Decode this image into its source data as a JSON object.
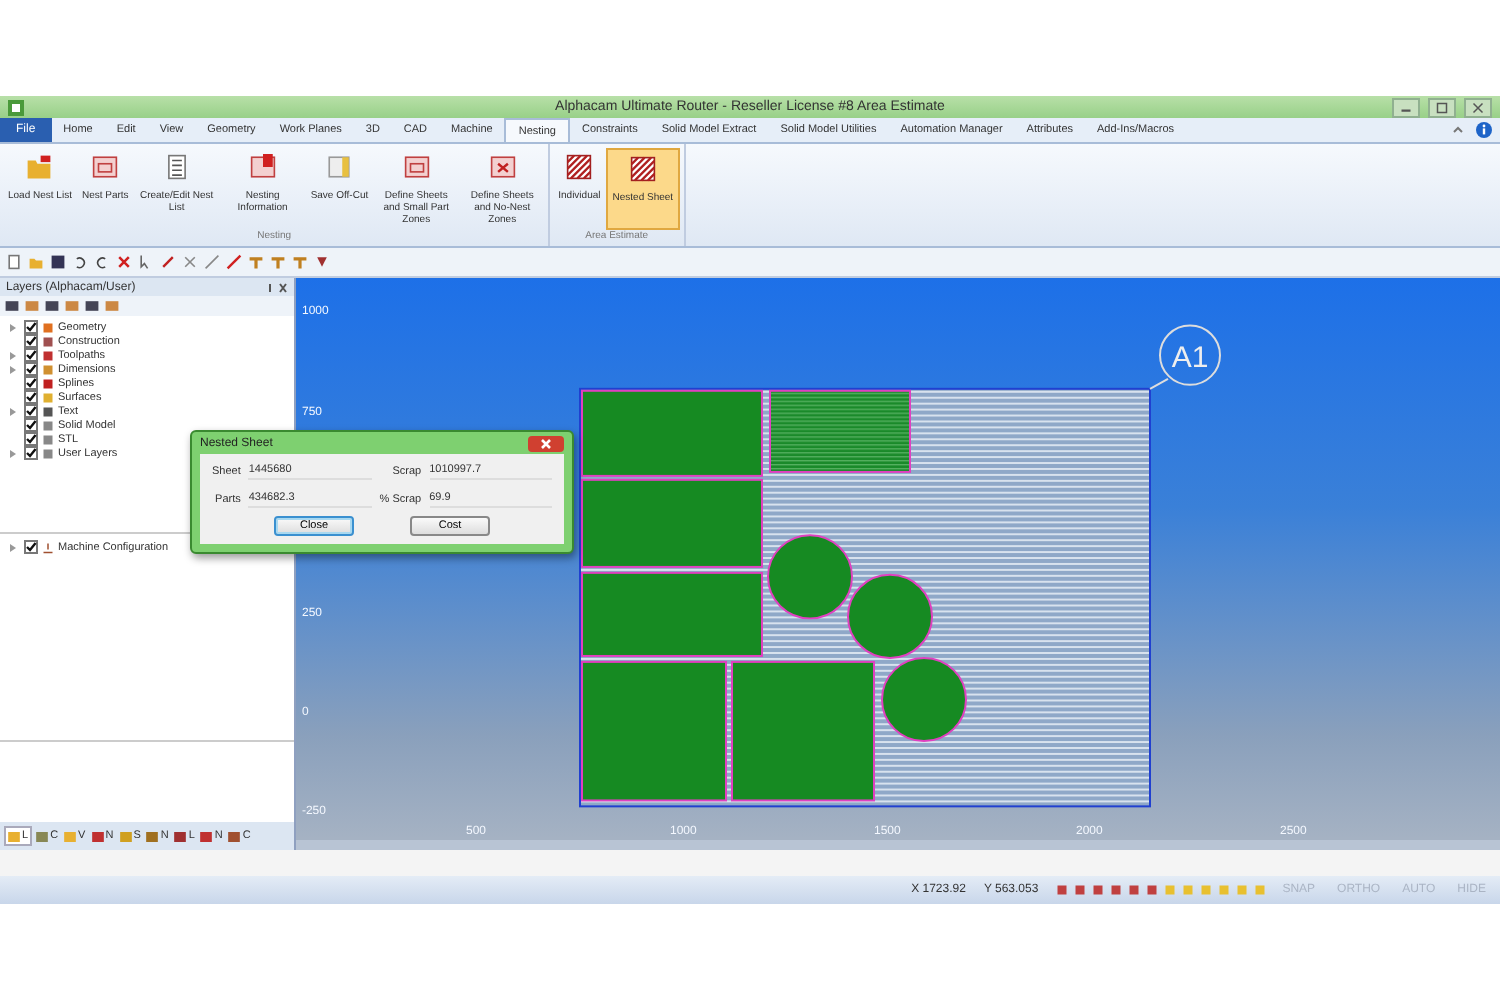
{
  "window": {
    "title": "Alphacam Ultimate Router - Reseller License #8 Area Estimate"
  },
  "tabs": [
    {
      "label": "File",
      "selected": false,
      "kind": "file"
    },
    {
      "label": "Home",
      "selected": false,
      "kind": "tab"
    },
    {
      "label": "Edit",
      "selected": false,
      "kind": "tab"
    },
    {
      "label": "View",
      "selected": false,
      "kind": "tab"
    },
    {
      "label": "Geometry",
      "selected": false,
      "kind": "tab"
    },
    {
      "label": "Work Planes",
      "selected": false,
      "kind": "tab"
    },
    {
      "label": "3D",
      "selected": false,
      "kind": "tab"
    },
    {
      "label": "CAD",
      "selected": false,
      "kind": "tab"
    },
    {
      "label": "Machine",
      "selected": false,
      "kind": "tab"
    },
    {
      "label": "Nesting",
      "selected": true,
      "kind": "tab"
    },
    {
      "label": "Constraints",
      "selected": false,
      "kind": "tab"
    },
    {
      "label": "Solid Model Extract",
      "selected": false,
      "kind": "tab"
    },
    {
      "label": "Solid Model Utilities",
      "selected": false,
      "kind": "tab"
    },
    {
      "label": "Automation Manager",
      "selected": false,
      "kind": "tab"
    },
    {
      "label": "Attributes",
      "selected": false,
      "kind": "tab"
    },
    {
      "label": "Add-Ins/Macros",
      "selected": false,
      "kind": "tab"
    }
  ],
  "ribbon_groups": [
    {
      "label": "Nesting",
      "buttons": [
        {
          "label": "Load Nest List",
          "selected": false
        },
        {
          "label": "Nest Parts",
          "selected": false
        },
        {
          "label": "Create/Edit Nest List",
          "selected": false
        },
        {
          "label": "Nesting Information",
          "selected": false
        },
        {
          "label": "Save Off-Cut",
          "selected": false
        },
        {
          "label": "Define Sheets and Small Part Zones",
          "selected": false
        },
        {
          "label": "Define Sheets and No-Nest Zones",
          "selected": false
        }
      ]
    },
    {
      "label": "Area Estimate",
      "buttons": [
        {
          "label": "Individual",
          "selected": false
        },
        {
          "label": "Nested Sheet",
          "selected": true
        }
      ]
    }
  ],
  "layers_panel": {
    "title": "Layers (Alphacam/User)",
    "items": [
      {
        "label": "Geometry",
        "expandable": true,
        "checked": true
      },
      {
        "label": "Construction",
        "expandable": false,
        "checked": true
      },
      {
        "label": "Toolpaths",
        "expandable": true,
        "checked": true
      },
      {
        "label": "Dimensions",
        "expandable": true,
        "checked": true
      },
      {
        "label": "Splines",
        "expandable": false,
        "checked": true
      },
      {
        "label": "Surfaces",
        "expandable": false,
        "checked": true
      },
      {
        "label": "Text",
        "expandable": true,
        "checked": true
      },
      {
        "label": "Solid Model",
        "expandable": false,
        "checked": true
      },
      {
        "label": "STL",
        "expandable": false,
        "checked": true
      },
      {
        "label": "User Layers",
        "expandable": true,
        "checked": true
      }
    ],
    "machine_items": [
      {
        "label": "Machine Configuration",
        "expandable": true,
        "checked": true
      }
    ],
    "bottom_tabs": [
      {
        "label": "L",
        "selected": true
      },
      {
        "label": "C",
        "selected": false
      },
      {
        "label": "V",
        "selected": false
      },
      {
        "label": "N",
        "selected": false
      },
      {
        "label": "S",
        "selected": false
      },
      {
        "label": "N",
        "selected": false
      },
      {
        "label": "L",
        "selected": false
      },
      {
        "label": "N",
        "selected": false
      },
      {
        "label": "C",
        "selected": false
      }
    ]
  },
  "canvas": {
    "y_labels": [
      "1000",
      "750",
      "250",
      "0",
      "-250"
    ],
    "x_labels": [
      "500",
      "1000",
      "1500",
      "2000",
      "2500"
    ],
    "sheet_label": "A1"
  },
  "dialog": {
    "title": "Nested Sheet",
    "fields": [
      {
        "label": "Sheet",
        "value": "1445680"
      },
      {
        "label": "Scrap",
        "value": "1010997.7"
      },
      {
        "label": "Parts",
        "value": "434682.3"
      },
      {
        "label": "% Scrap",
        "value": "69.9"
      }
    ],
    "buttons": [
      {
        "label": "Close",
        "selected": true
      },
      {
        "label": "Cost",
        "selected": false
      }
    ]
  },
  "status_bar": {
    "x": "X 1723.92",
    "y": "Y 563.053",
    "toggles": [
      {
        "label": "SNAP",
        "on": false
      },
      {
        "label": "ORTHO",
        "on": false
      },
      {
        "label": "AUTO",
        "on": false
      },
      {
        "label": "HIDE",
        "on": false
      }
    ]
  }
}
